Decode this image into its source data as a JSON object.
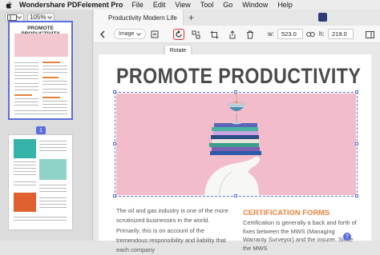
{
  "menubar": {
    "app_name": "Wondershare PDFelement Pro",
    "items": [
      "File",
      "Edit",
      "View",
      "Tool",
      "Go",
      "Window",
      "Help"
    ]
  },
  "sidebar": {
    "zoom_label": "105%",
    "active_page_number": "1",
    "thumb1_title": "PROMOTE PRODUCTIVITY"
  },
  "tabs": {
    "active_tab_label": "Productivity Modern Life"
  },
  "toolbar": {
    "element_type": "Image",
    "width_label": "w:",
    "width_value": "523.0",
    "height_label": "h:",
    "height_value": "219.0",
    "tooltip": "Rotate"
  },
  "document": {
    "title": "PROMOTE PRODUCTIVITY",
    "left_column": "The oil and gas industry is one of the more scrutinized businesses in the world. Primarily, this is on account of the tremendous responsibility and liability that each company",
    "cert_heading": "CERTIFICATION FORMS",
    "right_column": "Certification is generally a back and forth of fixes between the MWS (Managing Warranty Surveyor) and the insurer. Since the MWS"
  },
  "colors": {
    "accent": "#5b6ee0",
    "highlight": "#e03131",
    "heading_orange": "#e8823b",
    "photo_pink": "#f3bccb"
  }
}
